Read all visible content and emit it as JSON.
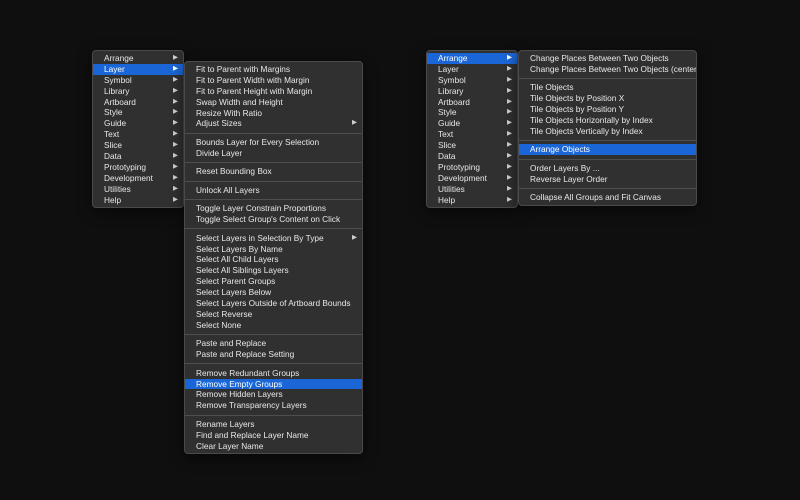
{
  "main_menu_left": {
    "items": [
      {
        "label": "Arrange",
        "arrow": "▶"
      },
      {
        "label": "Layer",
        "arrow": "▶"
      },
      {
        "label": "Symbol",
        "arrow": "▶"
      },
      {
        "label": "Library",
        "arrow": "▶"
      },
      {
        "label": "Artboard",
        "arrow": "▶"
      },
      {
        "label": "Style",
        "arrow": "▶"
      },
      {
        "label": "Guide",
        "arrow": "▶"
      },
      {
        "label": "Text",
        "arrow": "▶"
      },
      {
        "label": "Slice",
        "arrow": "▶"
      },
      {
        "label": "Data",
        "arrow": "▶"
      },
      {
        "label": "Prototyping",
        "arrow": "▶"
      },
      {
        "label": "Development",
        "arrow": "▶"
      },
      {
        "label": "Utilities",
        "arrow": "▶"
      },
      {
        "label": "Help",
        "arrow": "▶"
      }
    ]
  },
  "layer_submenu": {
    "groups": [
      [
        {
          "label": "Fit to Parent with Margins"
        },
        {
          "label": "Fit to Parent Width with Margin"
        },
        {
          "label": "Fit to Parent Height with Margin"
        },
        {
          "label": "Swap Width and Height"
        },
        {
          "label": "Resize With Ratio"
        },
        {
          "label": "Adjust Sizes",
          "arrow": "▶"
        }
      ],
      [
        {
          "label": "Bounds Layer for Every Selection"
        },
        {
          "label": "Divide Layer"
        }
      ],
      [
        {
          "label": "Reset Bounding Box"
        }
      ],
      [
        {
          "label": "Unlock All Layers"
        }
      ],
      [
        {
          "label": "Toggle Layer Constrain Proportions"
        },
        {
          "label": "Toggle Select Group's Content on Click"
        }
      ],
      [
        {
          "label": "Select Layers in Selection By Type",
          "arrow": "▶"
        },
        {
          "label": "Select Layers By Name"
        },
        {
          "label": "Select All Child Layers"
        },
        {
          "label": "Select All Siblings Layers"
        },
        {
          "label": "Select Parent Groups"
        },
        {
          "label": "Select Layers Below"
        },
        {
          "label": "Select Layers Outside of Artboard Bounds"
        },
        {
          "label": "Select Reverse"
        },
        {
          "label": "Select None"
        }
      ],
      [
        {
          "label": "Paste and Replace"
        },
        {
          "label": "Paste and Replace Setting"
        }
      ],
      [
        {
          "label": "Remove Redundant Groups"
        },
        {
          "label": "Remove Empty Groups"
        },
        {
          "label": "Remove Hidden Layers"
        },
        {
          "label": "Remove Transparency Layers"
        }
      ],
      [
        {
          "label": "Rename Layers"
        },
        {
          "label": "Find and Replace Layer Name"
        },
        {
          "label": "Clear Layer Name"
        }
      ]
    ]
  },
  "main_menu_right": {
    "items": [
      {
        "label": "Arrange",
        "arrow": "▶"
      },
      {
        "label": "Layer",
        "arrow": "▶"
      },
      {
        "label": "Symbol",
        "arrow": "▶"
      },
      {
        "label": "Library",
        "arrow": "▶"
      },
      {
        "label": "Artboard",
        "arrow": "▶"
      },
      {
        "label": "Style",
        "arrow": "▶"
      },
      {
        "label": "Guide",
        "arrow": "▶"
      },
      {
        "label": "Text",
        "arrow": "▶"
      },
      {
        "label": "Slice",
        "arrow": "▶"
      },
      {
        "label": "Data",
        "arrow": "▶"
      },
      {
        "label": "Prototyping",
        "arrow": "▶"
      },
      {
        "label": "Development",
        "arrow": "▶"
      },
      {
        "label": "Utilities",
        "arrow": "▶"
      },
      {
        "label": "Help",
        "arrow": "▶"
      }
    ]
  },
  "arrange_submenu": {
    "groups": [
      [
        {
          "label": "Change Places Between Two Objects"
        },
        {
          "label": "Change Places Between Two Objects (center)"
        }
      ],
      [
        {
          "label": "Tile Objects"
        },
        {
          "label": "Tile Objects by Position X"
        },
        {
          "label": "Tile Objects by Position Y"
        },
        {
          "label": "Tile Objects Horizontally by Index"
        },
        {
          "label": "Tile Objects Vertically by Index"
        }
      ],
      [
        {
          "label": "Arrange Objects"
        }
      ],
      [
        {
          "label": "Order Layers By ..."
        },
        {
          "label": "Reverse Layer Order"
        }
      ],
      [
        {
          "label": "Collapse All Groups and Fit Canvas"
        }
      ]
    ]
  },
  "highlight": {
    "main_menu_left": "Layer",
    "layer_submenu": "Remove Empty Groups",
    "main_menu_right": "Arrange",
    "arrange_submenu": "Arrange Objects"
  },
  "colors": {
    "background": "#0f0f0f",
    "menu": "#303030",
    "highlight": "#1b66d6",
    "text": "#e8e8e8",
    "separator": "#4e4e4e"
  }
}
